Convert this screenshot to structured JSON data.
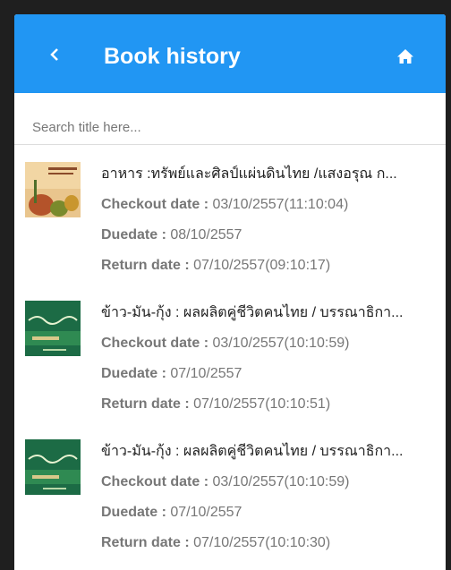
{
  "header": {
    "title": "Book history"
  },
  "search": {
    "placeholder": "Search title here..."
  },
  "labels": {
    "checkout": "Checkout date : ",
    "duedate": "Duedate : ",
    "return": "Return date : "
  },
  "books": [
    {
      "title": "อาหาร :ทรัพย์และศิลป์แผ่นดินไทย /แสงอรุณ ก...",
      "checkout": "03/10/2557(11:10:04)",
      "duedate": "08/10/2557",
      "return": "07/10/2557(09:10:17)"
    },
    {
      "title": "ข้าว-มัน-กุ้ง : ผลผลิตคู่ชีวิตคนไทย / บรรณาธิกา...",
      "checkout": "03/10/2557(10:10:59)",
      "duedate": "07/10/2557",
      "return": "07/10/2557(10:10:51)"
    },
    {
      "title": "ข้าว-มัน-กุ้ง : ผลผลิตคู่ชีวิตคนไทย / บรรณาธิกา...",
      "checkout": "03/10/2557(10:10:59)",
      "duedate": "07/10/2557",
      "return": "07/10/2557(10:10:30)"
    }
  ]
}
